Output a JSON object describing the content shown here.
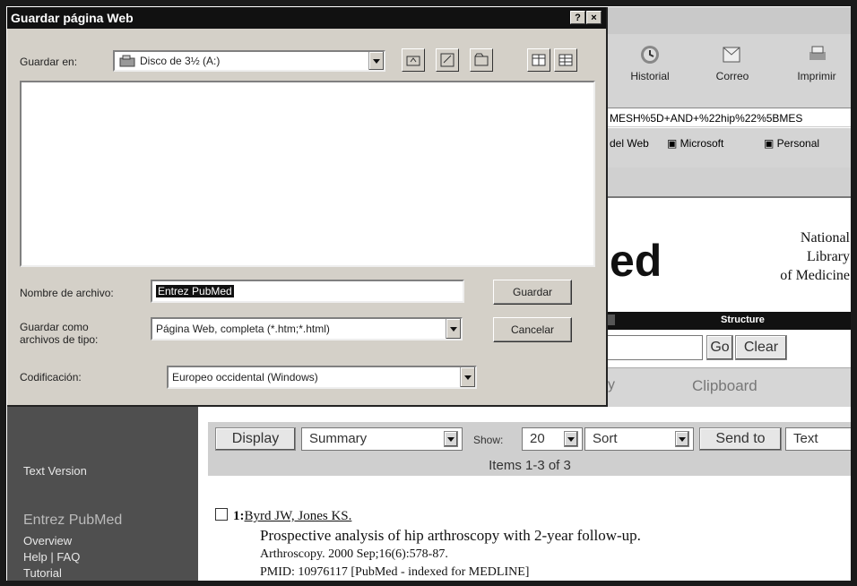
{
  "dialog": {
    "title": "Guardar página Web",
    "help_btn": "?",
    "close_btn": "×",
    "save_in_label": "Guardar en:",
    "save_in_value": "Disco de 3½ (A:)",
    "filename_label": "Nombre de archivo:",
    "filename_value": "Entrez PubMed",
    "save_as_type_label_1": "Guardar como",
    "save_as_type_label_2": "archivos de tipo:",
    "save_as_type_value": "Página Web, completa (*.htm;*.html)",
    "encoding_label": "Codificación:",
    "encoding_value": "Europeo occidental (Windows)",
    "save_button": "Guardar",
    "cancel_button": "Cancelar"
  },
  "browser": {
    "toolbar": [
      {
        "label": "Historial",
        "icon": "history-icon"
      },
      {
        "label": "Correo",
        "icon": "mail-icon"
      },
      {
        "label": "Imprimir",
        "icon": "printer-icon"
      }
    ],
    "address": "MESH%5D+AND+%22hip%22%5BMES",
    "links": [
      "del Web",
      "Microsoft",
      "Personal"
    ],
    "logo_fragment": "ed",
    "nlm": [
      "National",
      "Library",
      "of Medicine"
    ],
    "black_bar_label": "Structure",
    "go_button": "Go",
    "clear_button": "Clear",
    "clipboard": "Clipboard"
  },
  "leftnav": {
    "text_version": "Text Version",
    "section_title": "Entrez PubMed",
    "links": [
      "Overview",
      "Help | FAQ",
      "Tutorial"
    ]
  },
  "results": {
    "display_button": "Display",
    "display_value": "Summary",
    "show_label": "Show:",
    "show_value": "20",
    "sort_value": "Sort",
    "send_to_button": "Send to",
    "send_to_value": "Text",
    "items_text": "Items 1-3 of 3",
    "item": {
      "number": "1:",
      "authors": "Byrd JW, Jones KS.",
      "title": "Prospective analysis of hip arthroscopy with 2-year follow-up.",
      "citation": "Arthroscopy. 2000 Sep;16(6):578-87.",
      "pmid": "PMID: 10976117 [PubMed - indexed for MEDLINE]"
    }
  }
}
